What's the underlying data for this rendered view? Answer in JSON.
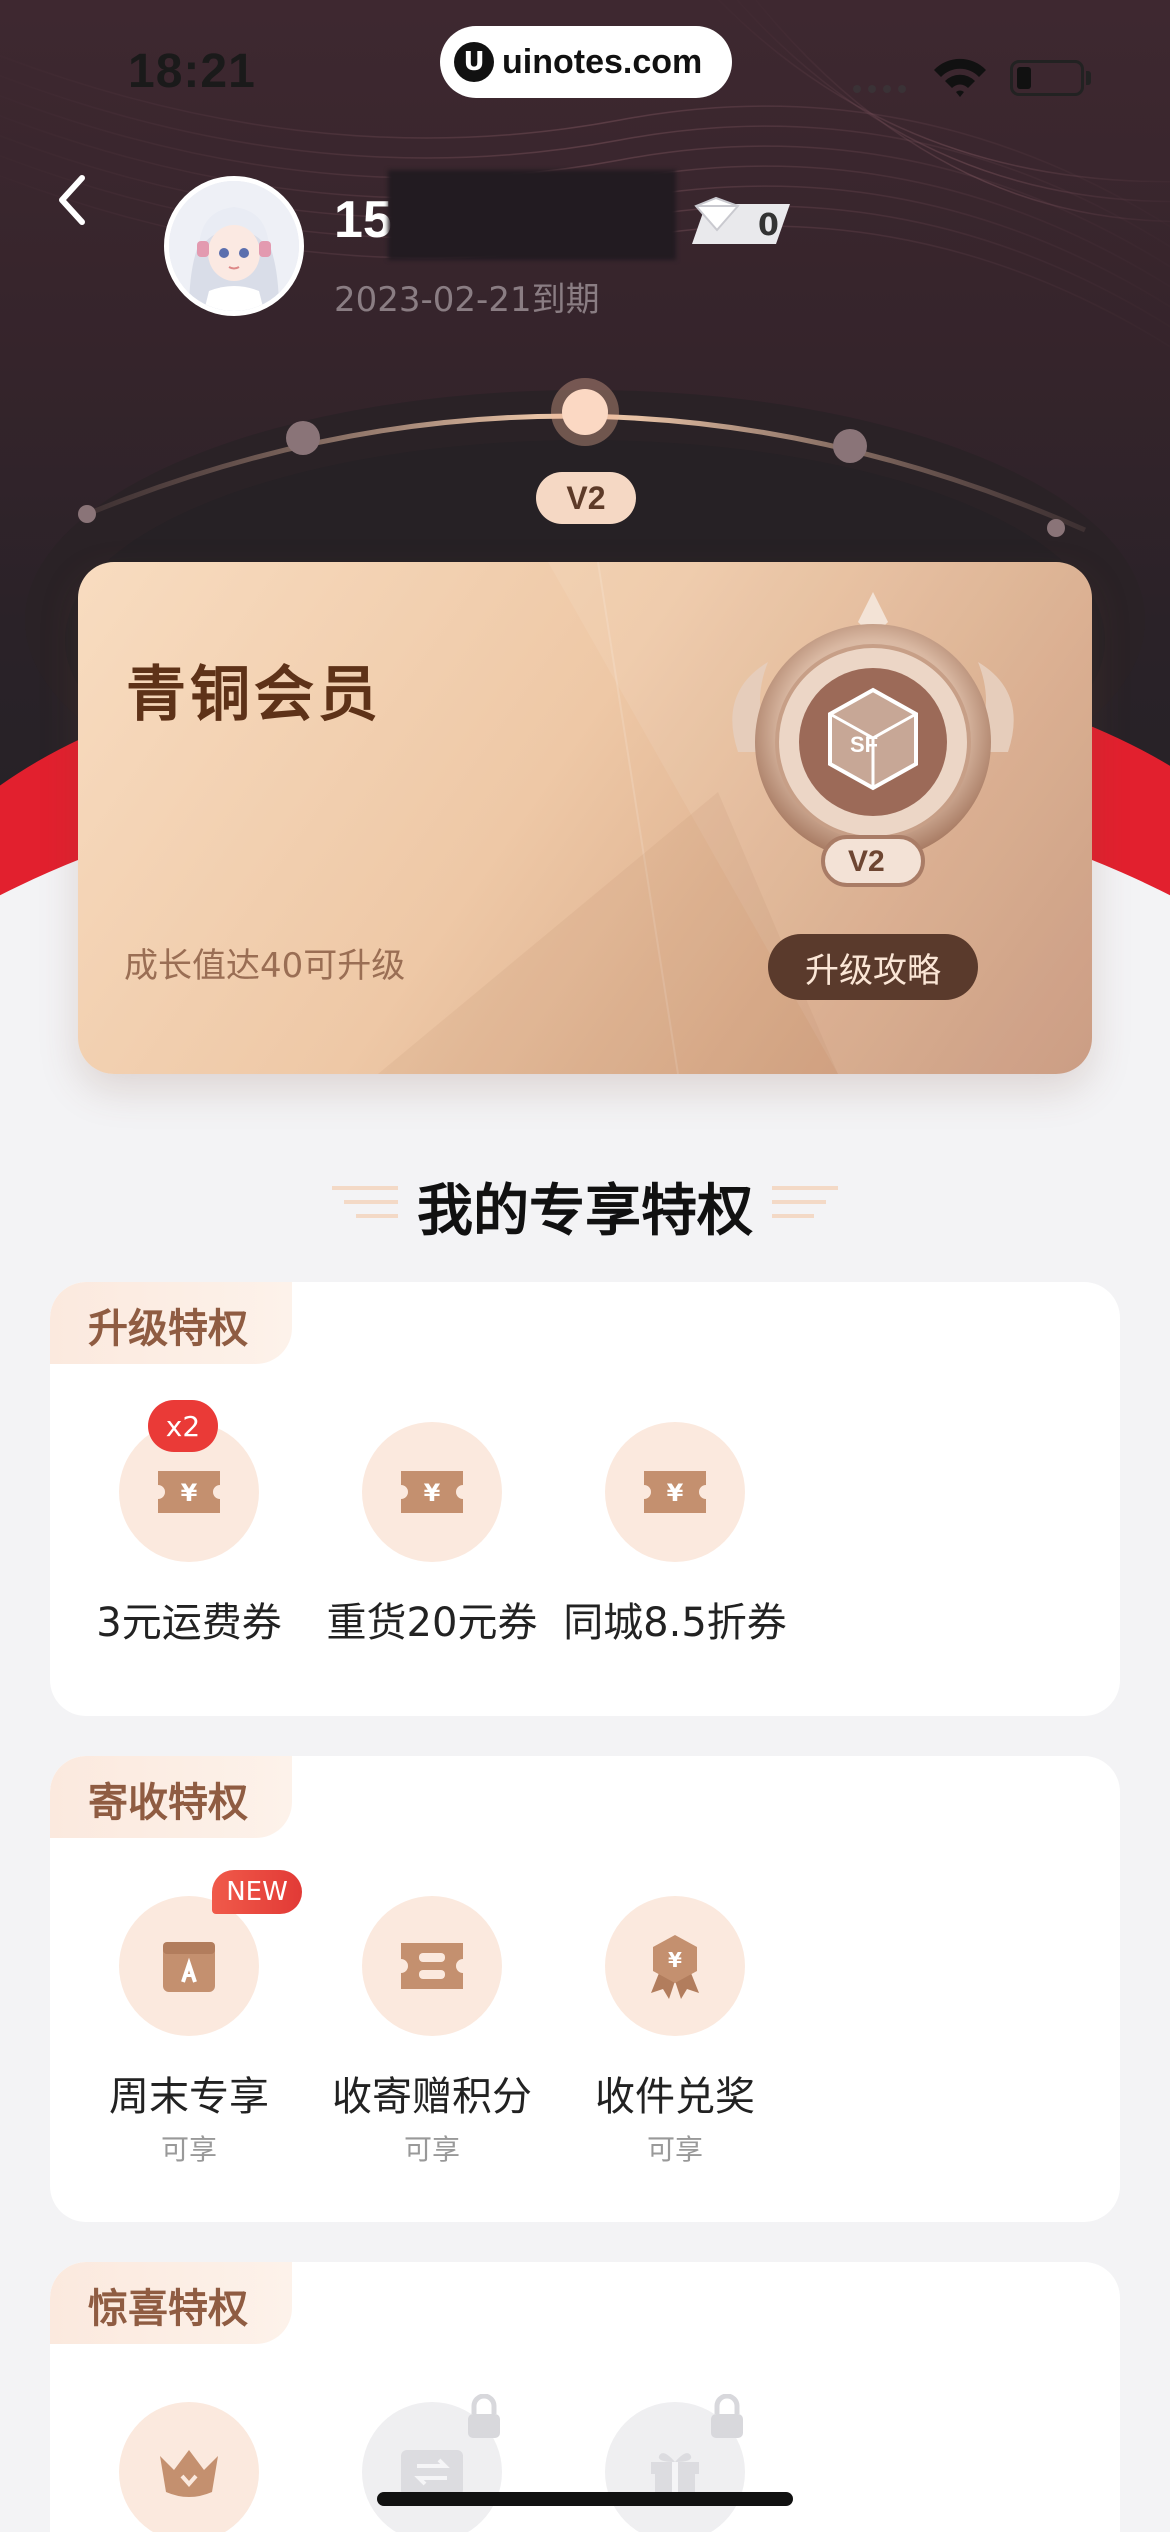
{
  "status_bar": {
    "time": "18:21",
    "site_badge": "uinotes.com"
  },
  "profile": {
    "name_prefix": "15",
    "vip_count": "0",
    "expiry": "2023-02-21到期"
  },
  "level_track": {
    "current_level": "V2"
  },
  "member_card": {
    "title": "青铜会员",
    "subtitle": "成长值达40可升级",
    "button_label": "升级攻略",
    "medal_label": "V2"
  },
  "section_heading": "我的专享特权",
  "panels": [
    {
      "tab_label": "升级特权",
      "items": [
        {
          "label": "3元运费券",
          "icon": "coupon-icon",
          "badge": "x2"
        },
        {
          "label": "重货20元券",
          "icon": "coupon-icon"
        },
        {
          "label": "同城8.5折券",
          "icon": "coupon-icon"
        }
      ]
    },
    {
      "tab_label": "寄收特权",
      "items": [
        {
          "label": "周末专享",
          "sub": "可享",
          "icon": "calendar-box-icon",
          "badge": "NEW"
        },
        {
          "label": "收寄赠积分",
          "sub": "可享",
          "icon": "points-ticket-icon"
        },
        {
          "label": "收件兑奖",
          "sub": "可享",
          "icon": "prize-ribbon-icon"
        }
      ]
    },
    {
      "tab_label": "惊喜特权",
      "items": [
        {
          "icon": "crown-icon",
          "locked": false
        },
        {
          "icon": "exchange-icon",
          "locked": true
        },
        {
          "icon": "gift-icon",
          "locked": true
        }
      ]
    }
  ],
  "colors": {
    "accent_red": "#e2202e",
    "card_brown": "#5e3218",
    "perk_bg": "#fbe9de",
    "perk_icon": "#c4906f"
  }
}
